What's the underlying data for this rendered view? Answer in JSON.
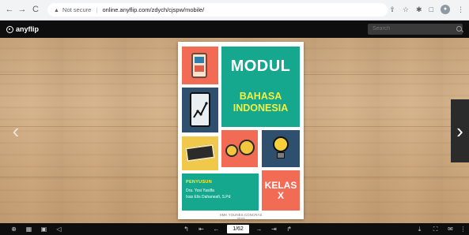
{
  "browser": {
    "nav": {
      "back": "←",
      "forward": "→",
      "reload": "C"
    },
    "address": {
      "security_label": "Not secure",
      "url": "online.anyflip.com/zdych/cjspw/mobile/"
    },
    "icons": [
      "share-icon",
      "star-icon",
      "extensions-icon",
      "window-icon",
      "profile-icon",
      "menu-icon"
    ]
  },
  "viewer": {
    "brand": "anyflip",
    "search_placeholder": "Search"
  },
  "cover": {
    "title": "MODUL",
    "subject_line1": "BAHASA",
    "subject_line2": "INDONESIA",
    "author_label": "PENYUSUN",
    "author_line1": "Dra. Yosi Yasilfa",
    "author_line2": "Ixas Elis Dahaneafi, S.Pd",
    "class_line1": "KELAS",
    "class_line2": "X",
    "school_line1": "SMK YOUNES CONCRAS",
    "school_line2": "2023"
  },
  "bottom_bar": {
    "page_indicator": "1/62"
  },
  "colors": {
    "teal": "#15a88f",
    "coral": "#f26b55",
    "navy": "#2f4f6e",
    "yellow": "#f2f040",
    "viewer_bg": "#0e0e0e"
  }
}
